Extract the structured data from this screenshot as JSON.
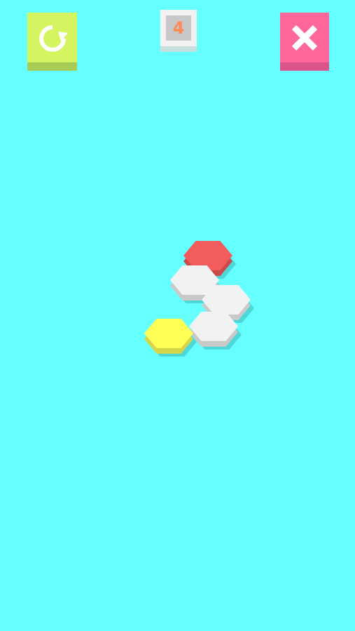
{
  "colors": {
    "background": "#66ffff",
    "restart_face": "#d4f55f",
    "restart_shade": "#a8cc55",
    "close_face": "#ff6699",
    "close_shade": "#d9558a",
    "badge_outer": "#f2f2f2",
    "badge_shade": "#c9dede",
    "badge_inner": "#c8c8c8",
    "badge_text": "#ff8855",
    "icon": "#ffffff",
    "tile_red": "#f25c5c",
    "tile_red_side": "#c94a4a",
    "tile_white": "#f2f2f2",
    "tile_white_side": "#c9c9c9",
    "tile_yellow": "#ffff55",
    "tile_yellow_side": "#d6d64a",
    "tile_shadow": "#4fd6d6"
  },
  "toolbar": {
    "restart": {
      "icon": "restart-icon"
    },
    "close": {
      "icon": "close-icon"
    },
    "level": "4"
  },
  "board": {
    "tiles": [
      {
        "name": "tile-red",
        "color": "red"
      },
      {
        "name": "tile-white-1",
        "color": "white"
      },
      {
        "name": "tile-white-2",
        "color": "white"
      },
      {
        "name": "tile-white-3",
        "color": "white"
      },
      {
        "name": "tile-yellow",
        "color": "yellow"
      }
    ]
  }
}
